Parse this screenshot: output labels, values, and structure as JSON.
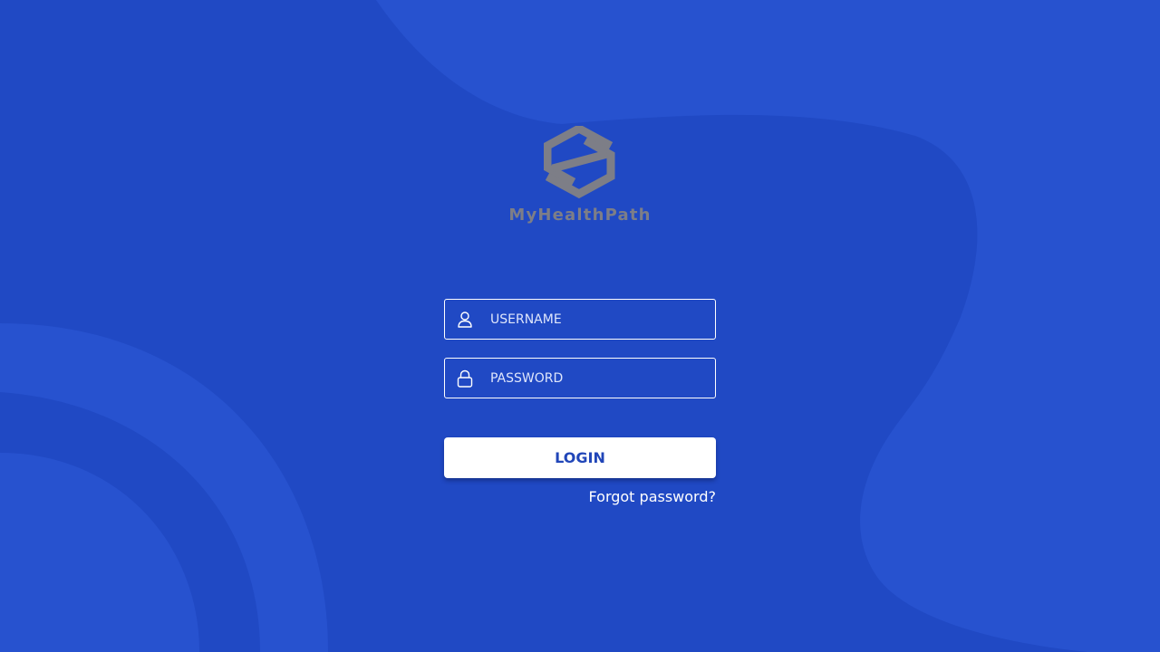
{
  "app": {
    "brand_name": "MyHealthPath"
  },
  "login_form": {
    "username": {
      "placeholder": "USERNAME",
      "value": "",
      "icon": "user-icon"
    },
    "password": {
      "placeholder": "PASSWORD",
      "value": "",
      "icon": "lock-icon"
    },
    "login_label": "LOGIN",
    "forgot_label": "Forgot password?"
  },
  "colors": {
    "background": "#2049c4",
    "background_shape": "#2752cf",
    "logo_gray": "#7d7e87",
    "button_bg": "#ffffff",
    "button_text": "#2146b8"
  }
}
